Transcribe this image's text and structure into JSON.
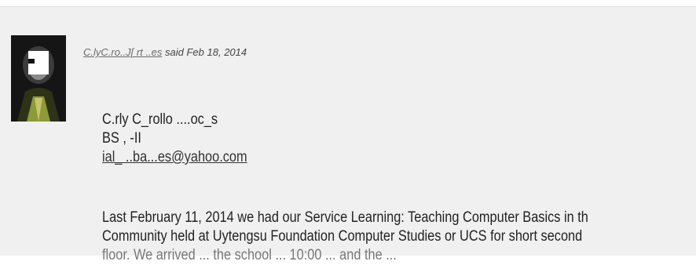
{
  "post": {
    "author": "C.lyC.ro..J[ rt ..es",
    "said_text": "said Feb 18, 2014",
    "signature": {
      "name": "C.rly C_rollo ....oc_s",
      "course": "BS , -II",
      "email": "ial_ ..ba...es@yahoo.com"
    },
    "body_lines": [
      "Last February 11, 2014 we had our Service Learning: Teaching Computer Basics in th",
      "Community held at Uytengsu Foundation Computer Studies or UCS for short second",
      "floor. We arrived ... the school ... 10:00 ... and the ..."
    ]
  }
}
